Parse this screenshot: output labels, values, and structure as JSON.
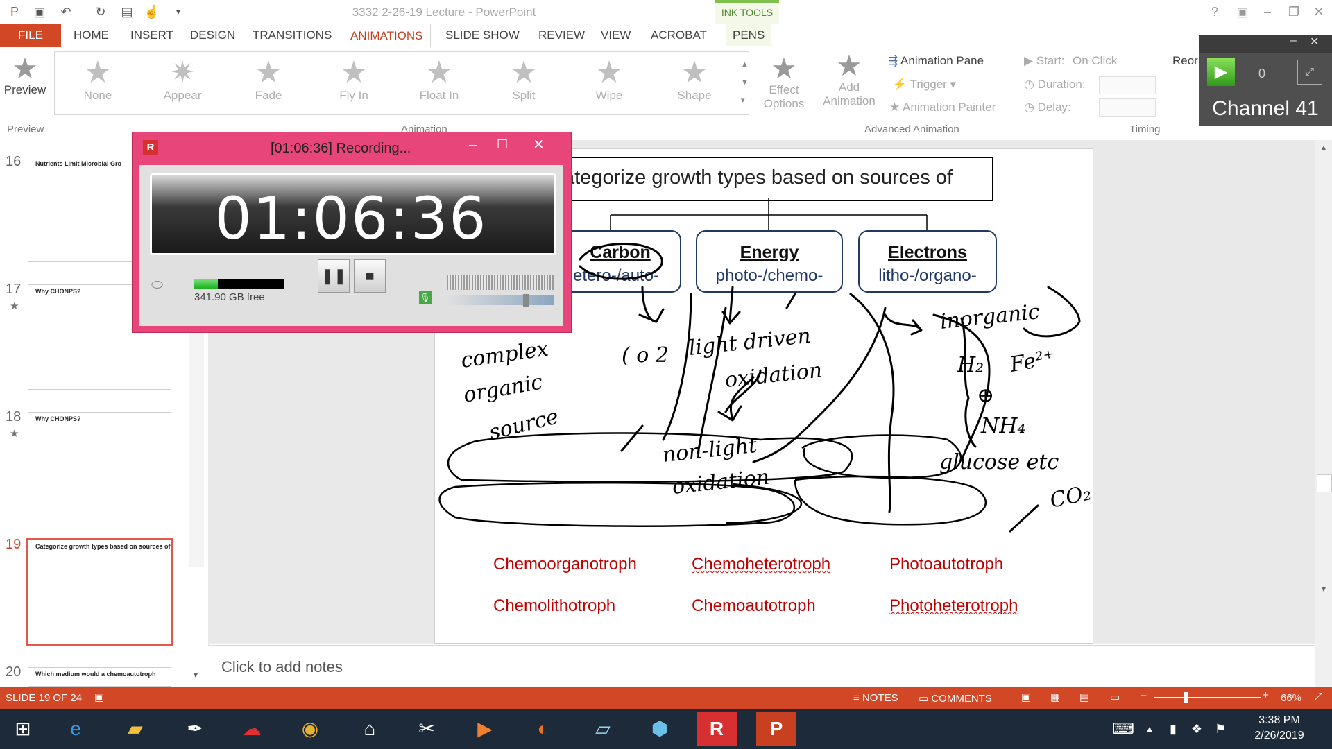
{
  "window": {
    "title": "3332 2-26-19 Lecture - PowerPoint",
    "context_tab": "INK TOOLS"
  },
  "menu": {
    "file": "FILE",
    "items": [
      "HOME",
      "INSERT",
      "DESIGN",
      "TRANSITIONS",
      "ANIMATIONS",
      "SLIDE SHOW",
      "REVIEW",
      "VIEW",
      "ACROBAT",
      "PENS"
    ]
  },
  "ribbon": {
    "preview": "Preview",
    "preview_group": "Preview",
    "animations": [
      "None",
      "Appear",
      "Fade",
      "Fly In",
      "Float In",
      "Split",
      "Wipe",
      "Shape"
    ],
    "animation_group": "Animation",
    "effect_options": [
      "Effect",
      "Options"
    ],
    "add_animation": [
      "Add",
      "Animation"
    ],
    "animation_pane": "Animation Pane",
    "trigger": "Trigger",
    "animation_painter": "Animation Painter",
    "advanced_group": "Advanced Animation",
    "start_label": "Start:",
    "start_value": "On Click",
    "duration_label": "Duration:",
    "delay_label": "Delay:",
    "timing_group": "Timing",
    "reorder": "Reor"
  },
  "channel_overlay": {
    "label": "Channel 41",
    "counter": "0"
  },
  "slides": [
    {
      "num": "16",
      "title": "Nutrients Limit Microbial Gro"
    },
    {
      "num": "17",
      "title": "Why CHONPS?"
    },
    {
      "num": "18",
      "title": "Why CHONPS?"
    },
    {
      "num": "19",
      "title": "Categorize growth types based on sources of"
    },
    {
      "num": "20",
      "title": "Which medium would a chemoautotroph"
    }
  ],
  "slide": {
    "title": "ategorize growth types based on sources of",
    "boxes": [
      {
        "head": "Carbon",
        "sub": "etero-/auto-"
      },
      {
        "head": "Energy",
        "sub": "photo-/chemo-"
      },
      {
        "head": "Electrons",
        "sub": "litho-/organo-"
      }
    ],
    "trophs": [
      "Chemoorganotroph",
      "Chemoheterotroph",
      "Photoautotroph",
      "Chemolithotroph",
      "Chemoautotroph",
      "Photoheterotroph"
    ]
  },
  "notes_placeholder": "Click to add notes",
  "status": {
    "slide_of": "SLIDE 19 OF 24",
    "notes": "NOTES",
    "comments": "COMMENTS",
    "zoom": "66%"
  },
  "recorder": {
    "title": "[01:06:36] Recording...",
    "time": "01:06:36",
    "disk_free": "341.90 GB free",
    "disk_used_fraction": 0.26
  },
  "clock": {
    "time": "3:38 PM",
    "date": "2/26/2019"
  }
}
